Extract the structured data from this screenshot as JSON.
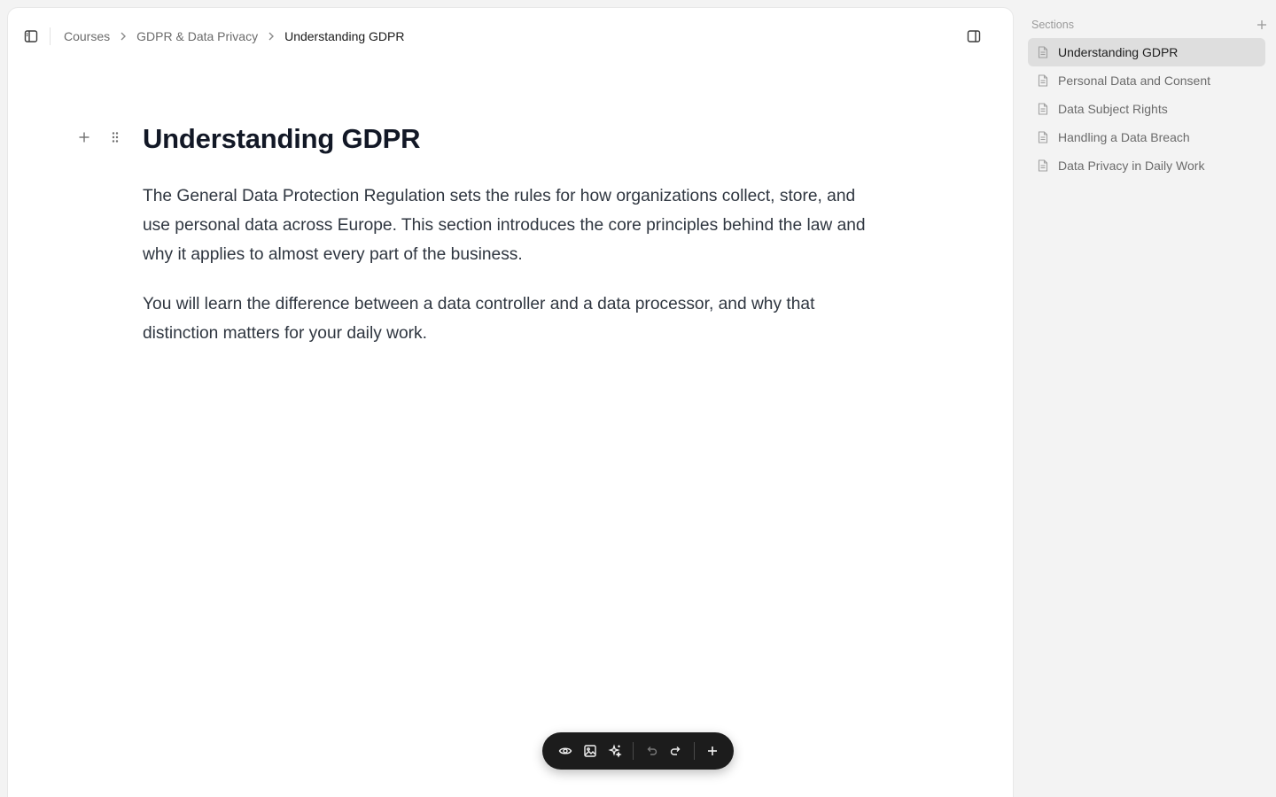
{
  "breadcrumb": {
    "items": [
      "Courses",
      "GDPR & Data Privacy"
    ],
    "current": "Understanding GDPR"
  },
  "document": {
    "title": "Understanding GDPR",
    "paragraphs": [
      "The General Data Protection Regulation sets the rules for how organizations collect, store, and use personal data across Europe. This section introduces the core principles behind the law and why it applies to almost every part of the business.",
      "You will learn the difference between a data controller and a data processor, and why that distinction matters for your daily work."
    ]
  },
  "sections": {
    "title": "Sections",
    "items": [
      {
        "label": "Understanding GDPR",
        "active": true
      },
      {
        "label": "Personal Data and Consent",
        "active": false
      },
      {
        "label": "Data Subject Rights",
        "active": false
      },
      {
        "label": "Handling a Data Breach",
        "active": false
      },
      {
        "label": "Data Privacy in Daily Work",
        "active": false
      }
    ]
  },
  "toolbar": {
    "buttons": [
      "eye-icon",
      "image-icon",
      "sparkles-icon",
      "undo-icon",
      "redo-icon",
      "plus-icon"
    ],
    "undo_disabled": true
  },
  "colors": {
    "toolbar_bg": "#1c1c1c",
    "active_section_bg": "#dedede",
    "title_color": "#121826"
  }
}
